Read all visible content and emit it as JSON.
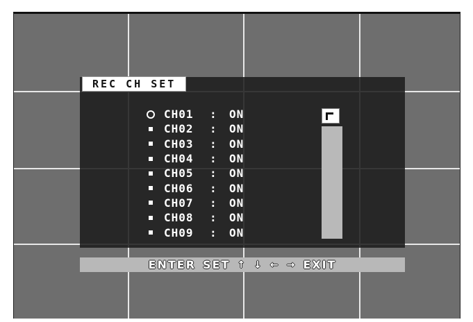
{
  "menu": {
    "title": "REC CH SET",
    "channels": [
      {
        "name": "CH01",
        "sep": ":",
        "state": "ON",
        "marker": "circle"
      },
      {
        "name": "CH02",
        "sep": ":",
        "state": "ON",
        "marker": "square"
      },
      {
        "name": "CH03",
        "sep": ":",
        "state": "ON",
        "marker": "square"
      },
      {
        "name": "CH04",
        "sep": ":",
        "state": "ON",
        "marker": "square"
      },
      {
        "name": "CH05",
        "sep": ":",
        "state": "ON",
        "marker": "square"
      },
      {
        "name": "CH06",
        "sep": ":",
        "state": "ON",
        "marker": "square"
      },
      {
        "name": "CH07",
        "sep": ":",
        "state": "ON",
        "marker": "square"
      },
      {
        "name": "CH08",
        "sep": ":",
        "state": "ON",
        "marker": "square"
      },
      {
        "name": "CH09",
        "sep": ":",
        "state": "ON",
        "marker": "square"
      }
    ]
  },
  "footer": {
    "enter": "ENTER",
    "set": "SET",
    "arrow_up": "↑",
    "arrow_down": "↓",
    "arrow_left": "←",
    "arrow_right": "→",
    "exit": "EXIT"
  },
  "colors": {
    "background": "#6e6e6e",
    "panel": "#1e1e1e",
    "highlight": "#ffffff",
    "footer": "#b8b8b8"
  },
  "icons": {
    "selected_marker": "circle-marker-icon",
    "unselected_marker": "square-marker-icon",
    "scroll_thumb": "scroll-thumb-icon"
  }
}
